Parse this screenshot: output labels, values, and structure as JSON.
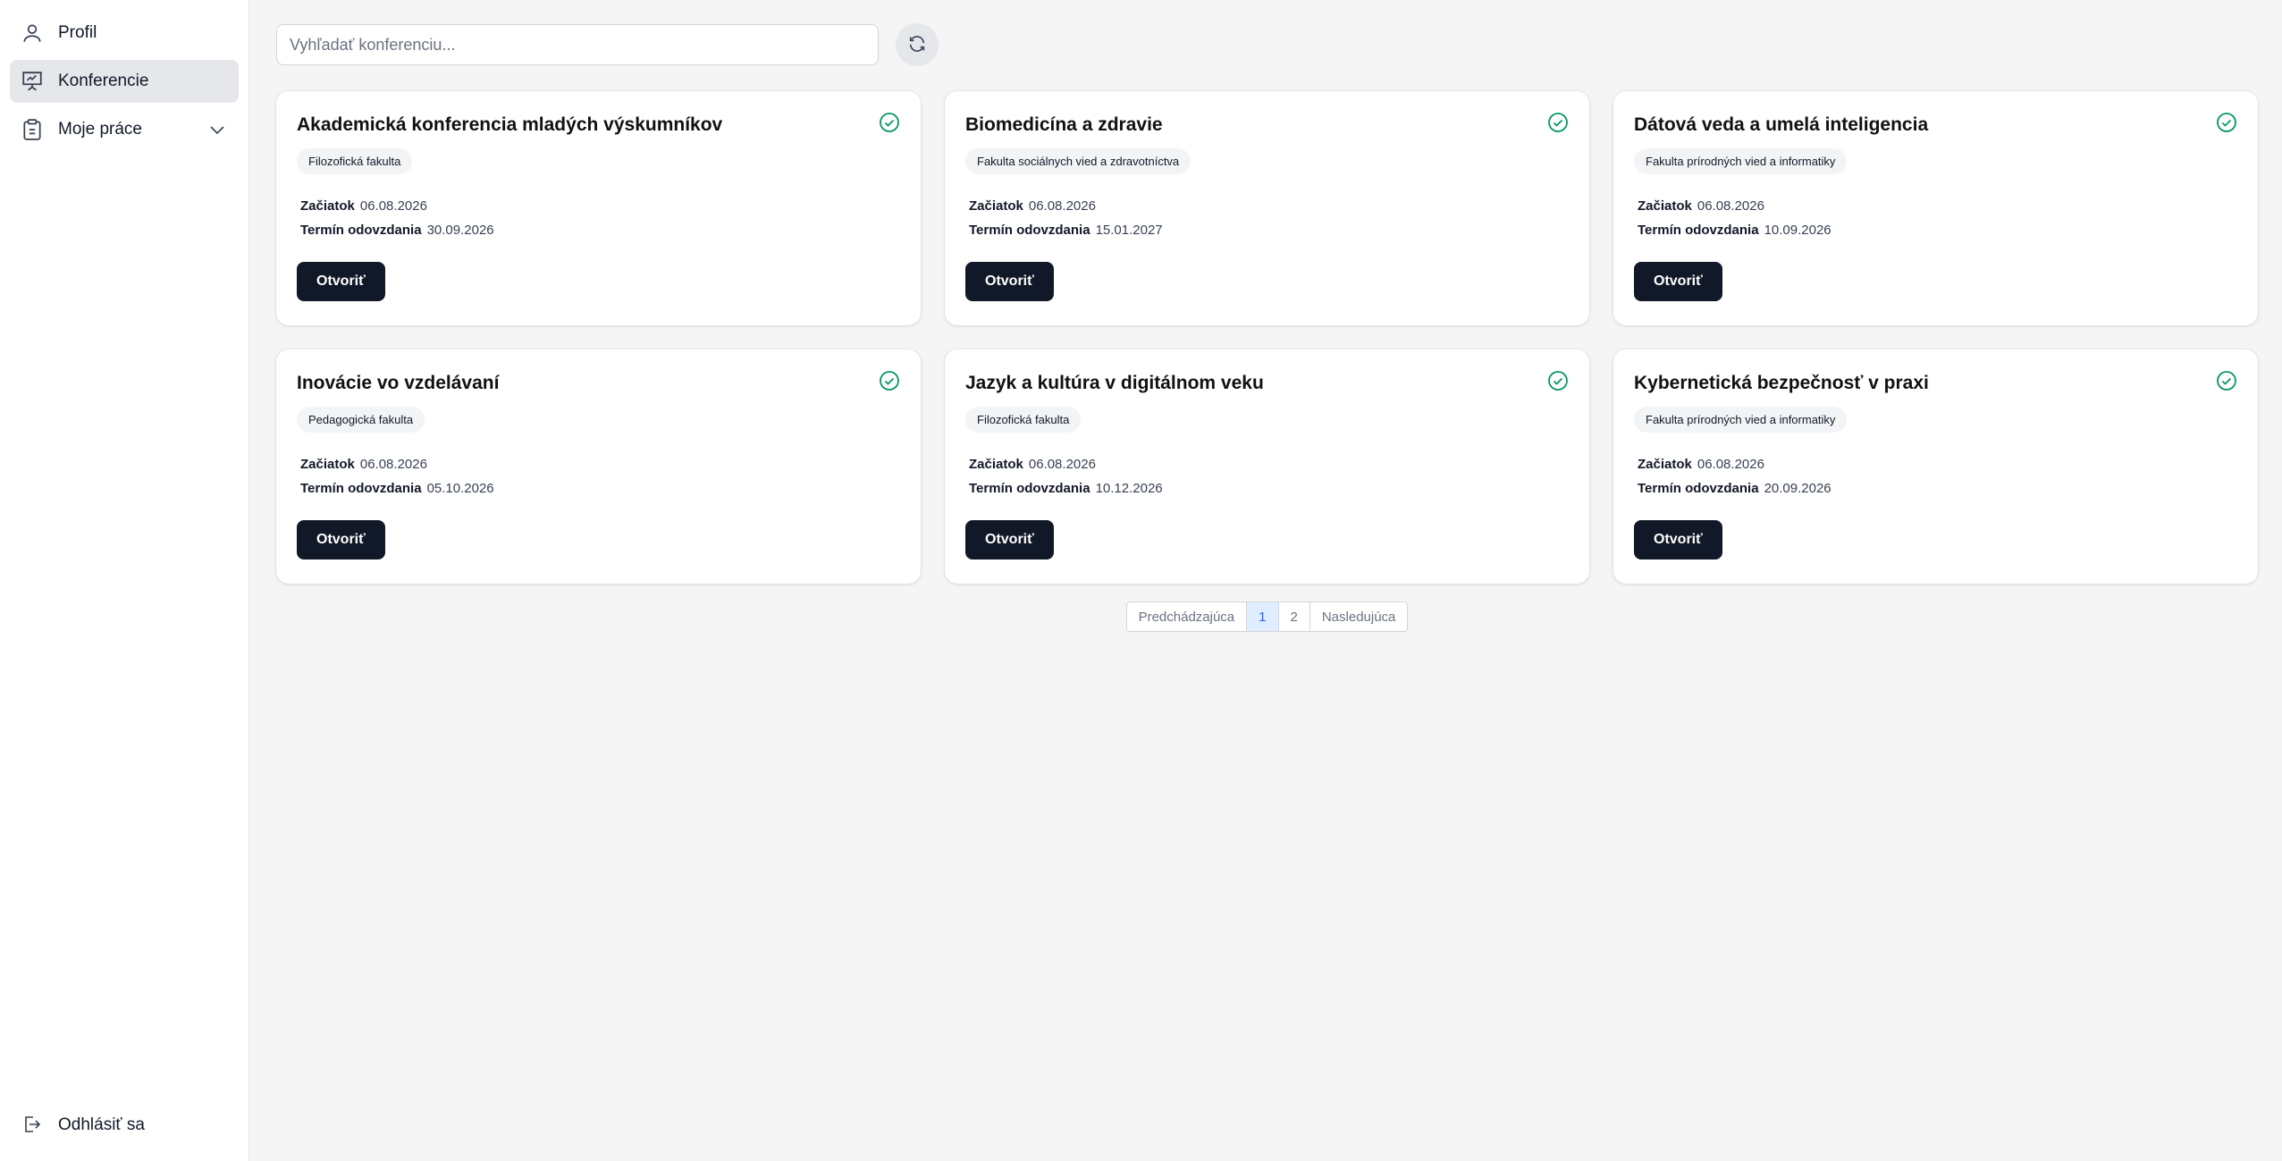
{
  "sidebar": {
    "items": [
      {
        "label": "Profil",
        "icon": "user-icon"
      },
      {
        "label": "Konferencie",
        "icon": "presentation-icon"
      },
      {
        "label": "Moje práce",
        "icon": "clipboard-icon"
      }
    ],
    "logout_label": "Odhlásiť sa"
  },
  "search": {
    "placeholder": "Vyhľadať konferenciu..."
  },
  "labels": {
    "start": "Začiatok",
    "deadline": "Termín odovzdania",
    "open": "Otvoriť"
  },
  "conferences": [
    {
      "title": "Akademická konferencia mladých výskumníkov",
      "faculty": "Filozofická fakulta",
      "start": "06.08.2026",
      "deadline": "30.09.2026"
    },
    {
      "title": "Biomedicína a zdravie",
      "faculty": "Fakulta sociálnych vied a zdravotníctva",
      "start": "06.08.2026",
      "deadline": "15.01.2027"
    },
    {
      "title": "Dátová veda a umelá inteligencia",
      "faculty": "Fakulta prírodných vied a informatiky",
      "start": "06.08.2026",
      "deadline": "10.09.2026"
    },
    {
      "title": "Inovácie vo vzdelávaní",
      "faculty": "Pedagogická fakulta",
      "start": "06.08.2026",
      "deadline": "05.10.2026"
    },
    {
      "title": "Jazyk a kultúra v digitálnom veku",
      "faculty": "Filozofická fakulta",
      "start": "06.08.2026",
      "deadline": "10.12.2026"
    },
    {
      "title": "Kybernetická bezpečnosť v praxi",
      "faculty": "Fakulta prírodných vied a informatiky",
      "start": "06.08.2026",
      "deadline": "20.09.2026"
    }
  ],
  "pagination": {
    "prev": "Predchádzajúca",
    "pages": [
      "1",
      "2"
    ],
    "next": "Nasledujúca"
  },
  "colors": {
    "accent_dark": "#111827",
    "check_green": "#059669",
    "active_page": "#2563eb"
  }
}
